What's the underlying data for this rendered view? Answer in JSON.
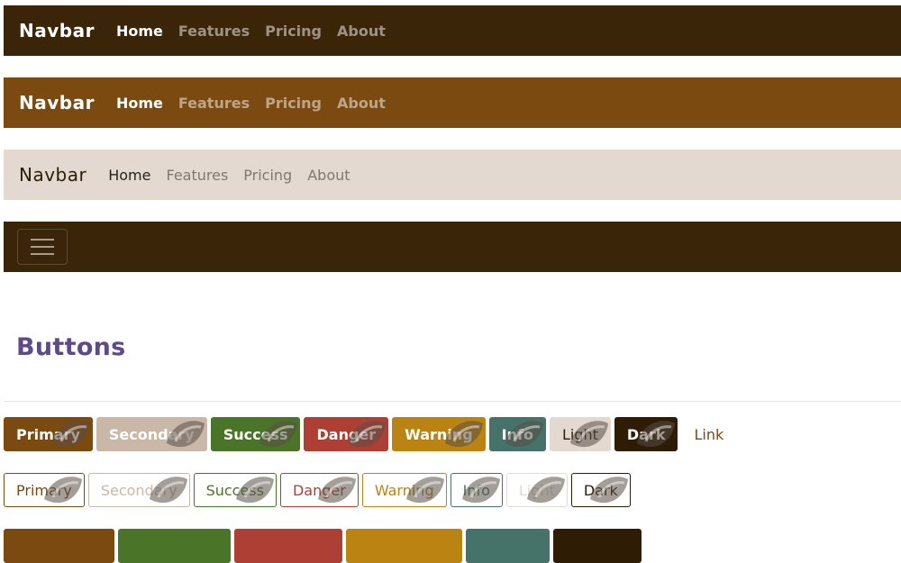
{
  "navbars": [
    {
      "style": "dark",
      "brand": "Navbar",
      "links": [
        "Home",
        "Features",
        "Pricing",
        "About"
      ]
    },
    {
      "style": "primary",
      "brand": "Navbar",
      "links": [
        "Home",
        "Features",
        "Pricing",
        "About"
      ]
    },
    {
      "style": "light",
      "brand": "Navbar",
      "links": [
        "Home",
        "Features",
        "Pricing",
        "About"
      ]
    }
  ],
  "collapsed_navbar": {
    "toggler_icon": "hamburger-icon"
  },
  "section": {
    "title": "Buttons"
  },
  "colors": {
    "primary": "#7a4a10",
    "secondary": "#c9b7a8",
    "success": "#4a7427",
    "danger": "#ad3f34",
    "warning": "#bb8312",
    "info": "#45736a",
    "light": "#e4d9d0",
    "dark": "#2e1c05",
    "title": "#5e4a88"
  },
  "buttons": {
    "solid": [
      {
        "label": "Primary",
        "variant": "primary"
      },
      {
        "label": "Secondary",
        "variant": "secondary"
      },
      {
        "label": "Success",
        "variant": "success"
      },
      {
        "label": "Danger",
        "variant": "danger"
      },
      {
        "label": "Warning",
        "variant": "warning"
      },
      {
        "label": "Info",
        "variant": "info"
      },
      {
        "label": "Light",
        "variant": "light"
      },
      {
        "label": "Dark",
        "variant": "dark"
      }
    ],
    "link": {
      "label": "Link"
    },
    "outline": [
      {
        "label": "Primary",
        "variant": "primary"
      },
      {
        "label": "Secondary",
        "variant": "secondary"
      },
      {
        "label": "Success",
        "variant": "success"
      },
      {
        "label": "Danger",
        "variant": "danger"
      },
      {
        "label": "Warning",
        "variant": "warning"
      },
      {
        "label": "Info",
        "variant": "info"
      },
      {
        "label": "Light",
        "variant": "light"
      },
      {
        "label": "Dark",
        "variant": "dark"
      }
    ],
    "row3_variants": [
      "primary",
      "success",
      "danger",
      "warning",
      "info",
      "dark"
    ]
  }
}
